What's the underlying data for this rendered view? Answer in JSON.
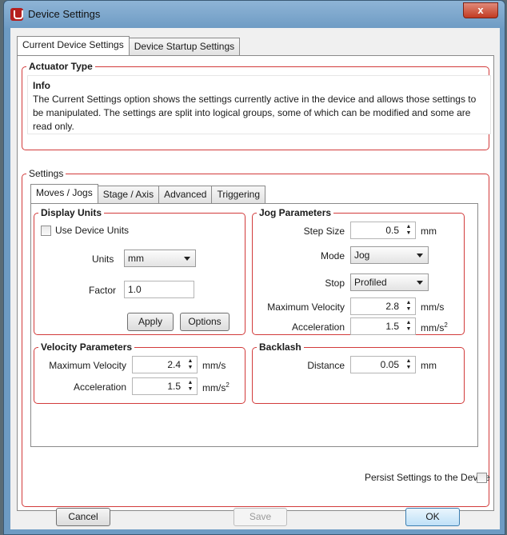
{
  "window": {
    "title": "Device Settings",
    "close_glyph": "x"
  },
  "tabs": [
    {
      "label": "Current Device Settings",
      "active": true
    },
    {
      "label": "Device Startup Settings",
      "active": false
    }
  ],
  "actuator": {
    "legend": "Actuator Type",
    "info_title": "Info",
    "info_text": "The Current Settings option shows the settings currently active in the device and allows those settings to be manipulated. The settings are split into logical groups, some of which can be modified and some are read only."
  },
  "settings": {
    "legend": "Settings",
    "tabs": [
      "Moves / Jogs",
      "Stage / Axis",
      "Advanced",
      "Triggering"
    ],
    "display_units": {
      "legend": "Display Units",
      "use_device_units": "Use Device Units",
      "units_label": "Units",
      "units_value": "mm",
      "factor_label": "Factor",
      "factor_value": "1.0",
      "apply": "Apply",
      "options": "Options"
    },
    "jog": {
      "legend": "Jog Parameters",
      "step_size_label": "Step Size",
      "step_size_value": "0.5",
      "step_size_unit": "mm",
      "mode_label": "Mode",
      "mode_value": "Jog",
      "stop_label": "Stop",
      "stop_value": "Profiled",
      "max_vel_label": "Maximum Velocity",
      "max_vel_value": "2.8",
      "max_vel_unit": "mm/s",
      "accel_label": "Acceleration",
      "accel_value": "1.5",
      "accel_unit": "mm/s",
      "accel_unit_sup": "2"
    },
    "velocity": {
      "legend": "Velocity Parameters",
      "max_vel_label": "Maximum Velocity",
      "max_vel_value": "2.4",
      "max_vel_unit": "mm/s",
      "accel_label": "Acceleration",
      "accel_value": "1.5",
      "accel_unit": "mm/s",
      "accel_unit_sup": "2"
    },
    "backlash": {
      "legend": "Backlash",
      "distance_label": "Distance",
      "distance_value": "0.05",
      "distance_unit": "mm"
    },
    "persist_label": "Persist Settings to the Device"
  },
  "footer": {
    "cancel": "Cancel",
    "save": "Save",
    "ok": "OK"
  },
  "colors": {
    "accent_red": "#d23b3b",
    "titlebar": "#6f9cc4",
    "close": "#c23b22"
  }
}
